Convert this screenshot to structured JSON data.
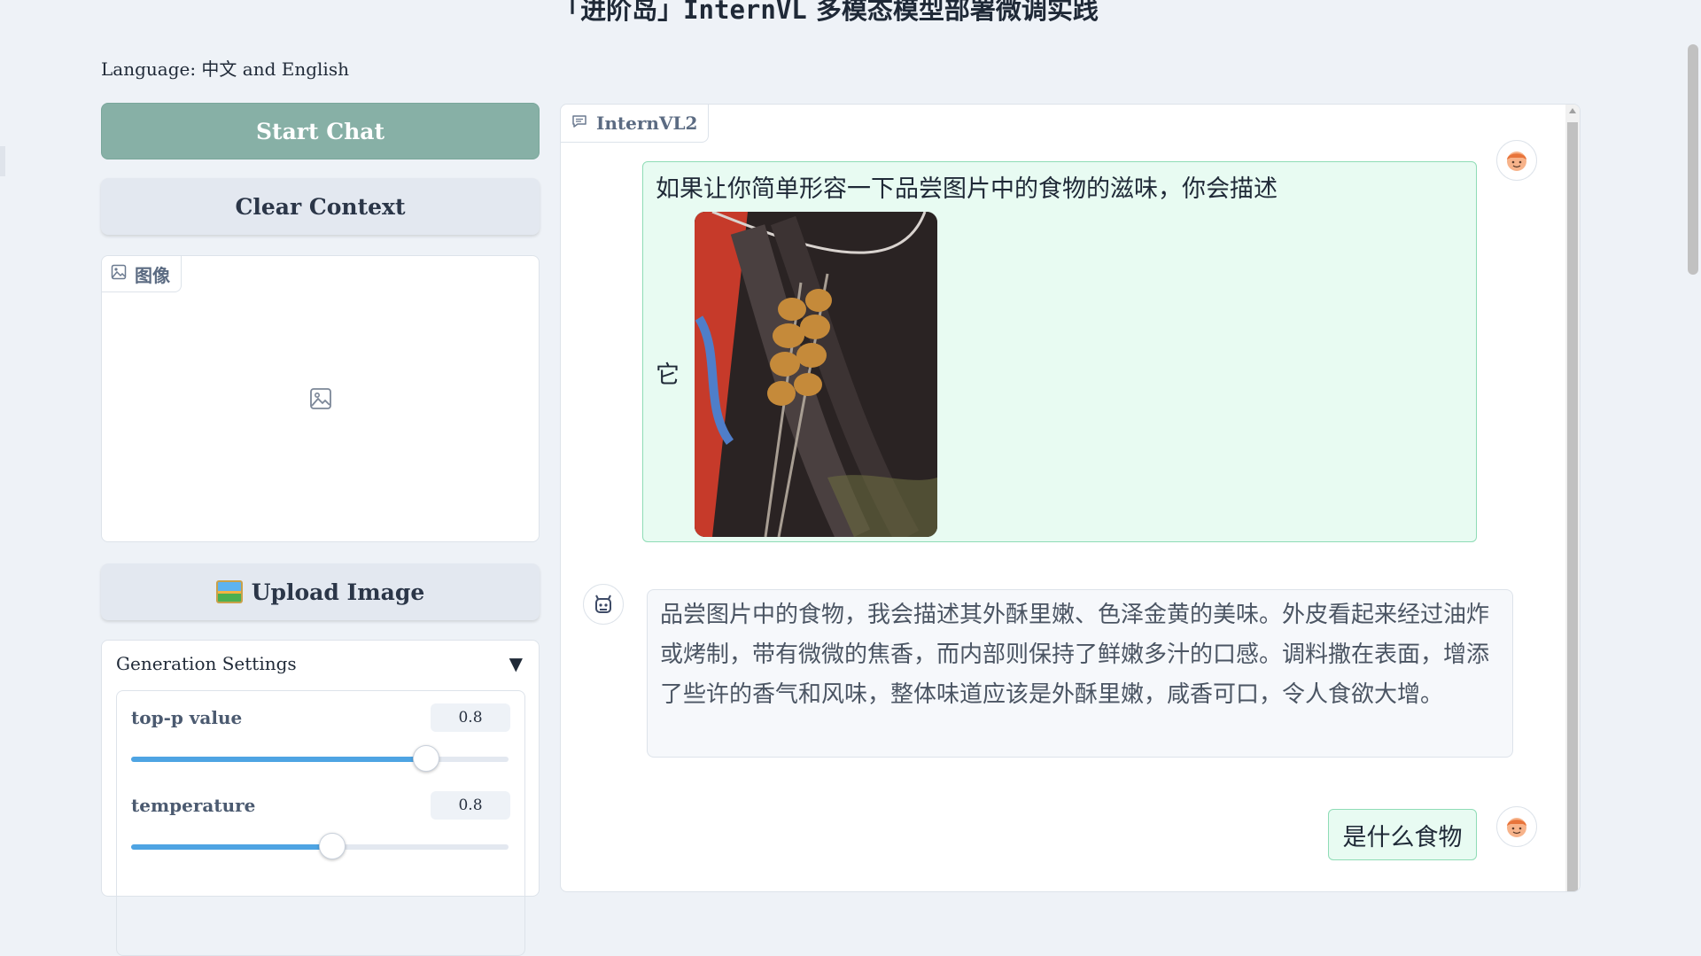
{
  "header": {
    "title_prefix": "「进阶岛」",
    "title_mono": "InternVL",
    "title_suffix": "多模态模型部署微调实践"
  },
  "language_line": "Language: 中文 and English",
  "buttons": {
    "start_chat": "Start Chat",
    "clear_context": "Clear Context",
    "upload_image": "Upload Image"
  },
  "image_panel": {
    "tab_label": "图像"
  },
  "settings": {
    "title": "Generation Settings",
    "caret": "▼",
    "sliders": [
      {
        "label": "top-p value",
        "value": "0.8",
        "level": 0.78
      },
      {
        "label": "temperature",
        "value": "0.8",
        "level": 0.53
      }
    ]
  },
  "chat": {
    "tab_label": "InternVL2",
    "messages": [
      {
        "role": "user",
        "text_line1": "如果让你简单形容一下品尝图片中的食物的滋味，你会描述",
        "text_line2": "它"
      },
      {
        "role": "bot",
        "text": "品尝图片中的食物，我会描述其外酥里嫩、色泽金黄的美味。外皮看起来经过油炸或烤制，带有微微的焦香，而内部则保持了鲜嫩多汁的口感。调料撒在表面，增添了些许的香气和风味，整体味道应该是外酥里嫩，咸香可口，令人食欲大增。"
      },
      {
        "role": "user",
        "text": "是什么食物"
      }
    ]
  },
  "colors": {
    "start_button": "#87b0a6",
    "user_bubble": "#e8fbf2",
    "slider_fill": "#4ea4e3"
  }
}
